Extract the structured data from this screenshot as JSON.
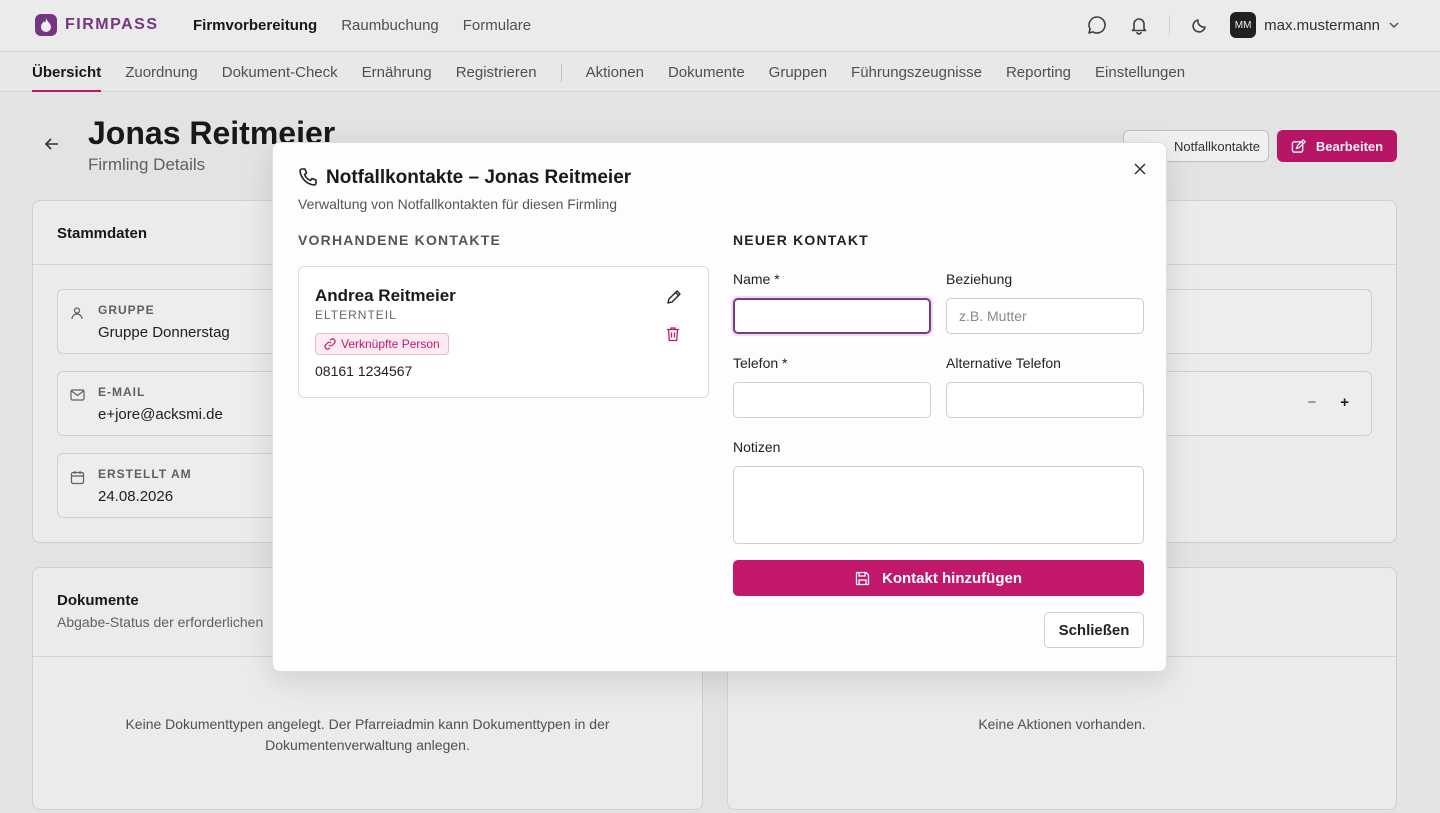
{
  "app": {
    "brand": "FIRMPASS"
  },
  "topnav": {
    "items": [
      "Firmvorbereitung",
      "Raumbuchung",
      "Formulare"
    ]
  },
  "user": {
    "initials": "MM",
    "name": "max.mustermann"
  },
  "subnav": {
    "group1": [
      "Übersicht",
      "Zuordnung",
      "Dokument-Check",
      "Ernährung",
      "Registrieren"
    ],
    "group2": [
      "Aktionen",
      "Dokumente",
      "Gruppen",
      "Führungszeugnisse",
      "Reporting",
      "Einstellungen"
    ]
  },
  "page": {
    "title": "Jonas Reitmeier",
    "subtitle": "Firmling Details",
    "notf_button": "Notfallkontakte",
    "edit_button": "Bearbeiten"
  },
  "stamm": {
    "title": "Stammdaten",
    "fields": [
      {
        "label": "GRUPPE",
        "value": "Gruppe Donnerstag"
      },
      {
        "label": "E-MAIL",
        "value": "e+jore@acksmi.de"
      },
      {
        "label": "ERSTELLT AM",
        "value": "24.08.2026"
      }
    ],
    "stepper_minus": "−",
    "stepper_plus": "+"
  },
  "docs": {
    "title": "Dokumente",
    "subtitle": "Abgabe-Status der erforderlichen",
    "empty": "Keine Dokumenttypen angelegt. Der Pfarreiadmin kann Dokumenttypen in der Dokumentenverwaltung anlegen."
  },
  "actions": {
    "empty": "Keine Aktionen vorhanden."
  },
  "modal": {
    "title": "Notfallkontakte – Jonas Reitmeier",
    "subtitle": "Verwaltung von Notfallkontakten für diesen Firmling",
    "existing_label": "VORHANDENE KONTAKTE",
    "new_label": "NEUER KONTAKT",
    "contact": {
      "name": "Andrea Reitmeier",
      "relation": "ELTERNTEIL",
      "badge": "Verknüpfte Person",
      "phone": "08161 1234567"
    },
    "form": {
      "name_label": "Name *",
      "name_value": "",
      "relation_label": "Beziehung",
      "relation_placeholder": "z.B. Mutter",
      "phone_label": "Telefon *",
      "alt_phone_label": "Alternative Telefon",
      "notes_label": "Notizen"
    },
    "add_button": "Kontakt hinzufügen",
    "close_button": "Schließen"
  },
  "colors": {
    "brand": "#7c3a86",
    "accent": "#c2186c"
  }
}
